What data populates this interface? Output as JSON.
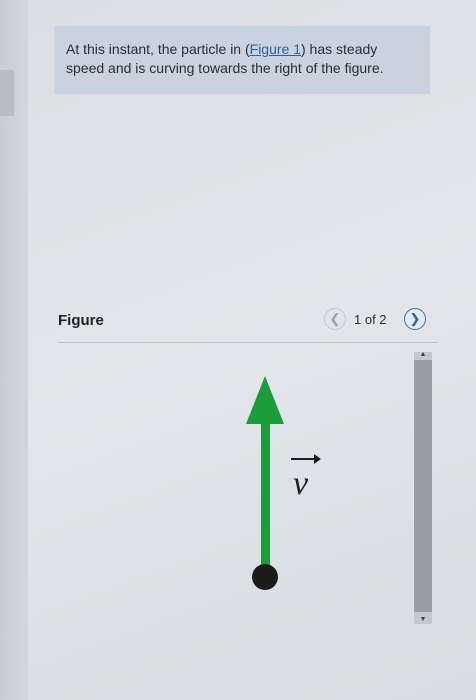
{
  "prompt": {
    "text_before": "At this instant, the particle in (",
    "link_label": "Figure 1",
    "text_after": ") has steady speed and is curving towards the right of the figure."
  },
  "figure": {
    "title": "Figure",
    "page_indicator": "1 of 2",
    "prev_icon": "chevron-left-icon",
    "next_icon": "chevron-right-icon",
    "vector_label": "v",
    "arrow_color": "#1a9e3a",
    "particle_color": "#1c1c1c"
  },
  "colors": {
    "link": "#2f5f9c",
    "prompt_bg": "#c9d3df",
    "scroll_thumb": "#979ca7"
  }
}
